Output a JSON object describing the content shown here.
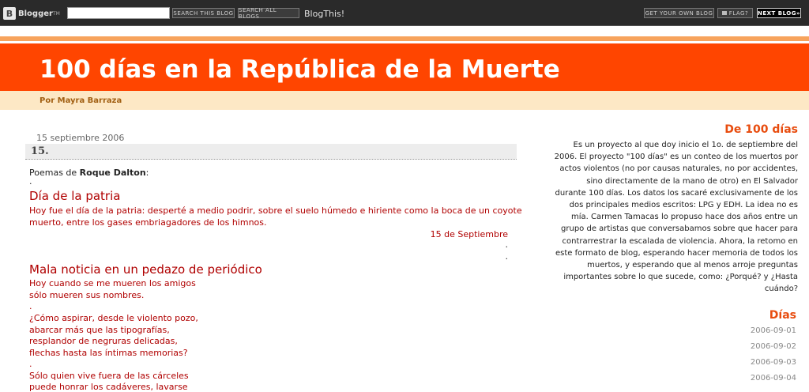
{
  "navbar": {
    "logo_text": "Blogger",
    "logo_tm": "TM",
    "search_this_blog": "SEARCH THIS BLOG",
    "search_all_blogs": "SEARCH ALL BLOGS",
    "blogthis": "BlogThis!",
    "get_your_own": "GET YOUR OWN BLOG",
    "flag": "FLAG?",
    "next_blog": "NEXT BLOG»"
  },
  "header": {
    "title": "100 días en la República de la Muerte",
    "author": "Por Mayra Barraza"
  },
  "post": {
    "date": "15 septiembre 2006",
    "title": "15.",
    "intro_prefix": "Poemas de ",
    "intro_author": "Roque Dalton",
    "intro_suffix": ":",
    "dot": ".",
    "poem1_title": "Día de la patria",
    "poem1_lines": [
      "Hoy fue el día de la patria: desperté a medio podrir, sobre el suelo húmedo e hiriente como la boca de un coyote",
      "muerto, entre los gases embriagadores de los himnos."
    ],
    "poem1_date": "15 de Septiembre",
    "poem2_title": "Mala noticia en un pedazo de periódico",
    "poem2_lines": [
      "Hoy cuando se me mueren los amigos",
      "sólo mueren sus nombres.",
      ".",
      "¿Cómo aspirar, desde le violento pozo,",
      "abarcar más que las tipografías,",
      "resplandor de negruras delicadas,",
      "flechas hasta las íntimas memorias?",
      ".",
      "Sólo quien vive fuera de las cárceles",
      "puede honrar los cadáveres, lavarse"
    ]
  },
  "sidebar": {
    "about_title": "De 100 días",
    "about_lines": [
      "Es un proyecto al que doy inicio el 1o. de septiembre del",
      "2006. El proyecto \"100 días\" es un conteo de los muertos por",
      "actos violentos (no por causas naturales, no por accidentes,",
      "sino directamente de la mano de otro) en El Salvador",
      "durante 100 días. Los datos los sacaré exclusivamente de los",
      "dos principales medios escritos: LPG y EDH. La idea no es",
      "mía. Carmen Tamacas lo propuso hace dos años entre un",
      "grupo de artistas que conversabamos sobre que hacer para",
      "contrarrestrar la escalada de violencia. Ahora, la retomo en",
      "este formato de blog, esperando hacer memoria de todos los",
      "muertos, y esperando que al menos arroje preguntas",
      "importantes sobre lo que sucede, como: ¿Porqué? y ¿Hasta",
      "cuándo?"
    ],
    "days_title": "Días",
    "days": [
      "2006-09-01",
      "2006-09-02",
      "2006-09-03",
      "2006-09-04"
    ]
  }
}
